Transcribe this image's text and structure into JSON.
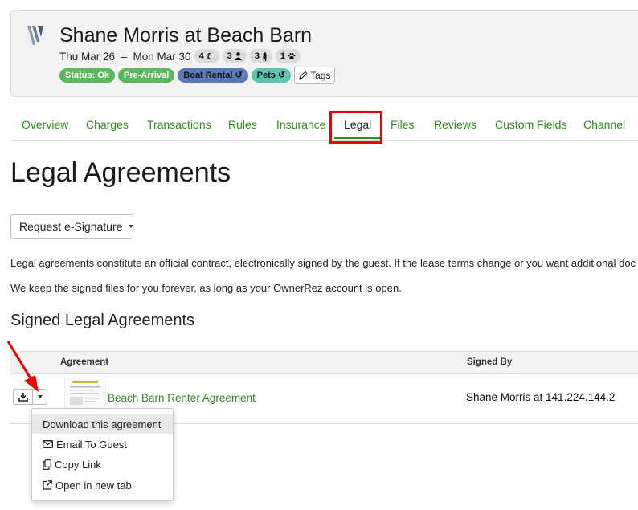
{
  "header": {
    "title": "Shane Morris at Beach Barn",
    "dates": "Thu Mar 26  –  Mon Mar 30",
    "stats": [
      {
        "value": "4",
        "icon": "moon-icon"
      },
      {
        "value": "3",
        "icon": "adult-icon"
      },
      {
        "value": "3",
        "icon": "child-icon"
      },
      {
        "value": "1",
        "icon": "paw-icon"
      }
    ],
    "badges": [
      {
        "label": "Status: Ok",
        "color": "#5cb85c"
      },
      {
        "label": "Pre-Arrival",
        "color": "#5cb85c"
      },
      {
        "label": "Boat Rental",
        "color": "#5a7ab5"
      },
      {
        "label": "Pets",
        "color": "#5ec4b0"
      }
    ],
    "tags_label": "Tags"
  },
  "tabs": [
    "Overview",
    "Charges",
    "Transactions",
    "Rules",
    "Insurance",
    "Legal",
    "Files",
    "Reviews",
    "Custom Fields",
    "Channel"
  ],
  "active_tab": "Legal",
  "page_title": "Legal Agreements",
  "request_button": "Request e-Signature",
  "paragraphs": [
    "Legal agreements constitute an official contract, electronically signed by the guest. If the lease terms change or you want additional doc",
    "We keep the signed files for you forever, as long as your OwnerRez account is open."
  ],
  "section_title": "Signed Legal Agreements",
  "table": {
    "columns": [
      "Agreement",
      "Signed By"
    ],
    "rows": [
      {
        "agreement": "Beach Barn Renter Agreement",
        "signed_by": "Shane Morris at 141.224.144.2"
      }
    ]
  },
  "dropdown_menu": [
    {
      "label": "Download this agreement",
      "icon": ""
    },
    {
      "label": "Email To Guest",
      "icon": "envelope-icon"
    },
    {
      "label": "Copy Link",
      "icon": "copy-icon"
    },
    {
      "label": "Open in new tab",
      "icon": "external-link-icon"
    }
  ],
  "colors": {
    "accent": "#2e8b1f",
    "highlight": "#e00000"
  }
}
